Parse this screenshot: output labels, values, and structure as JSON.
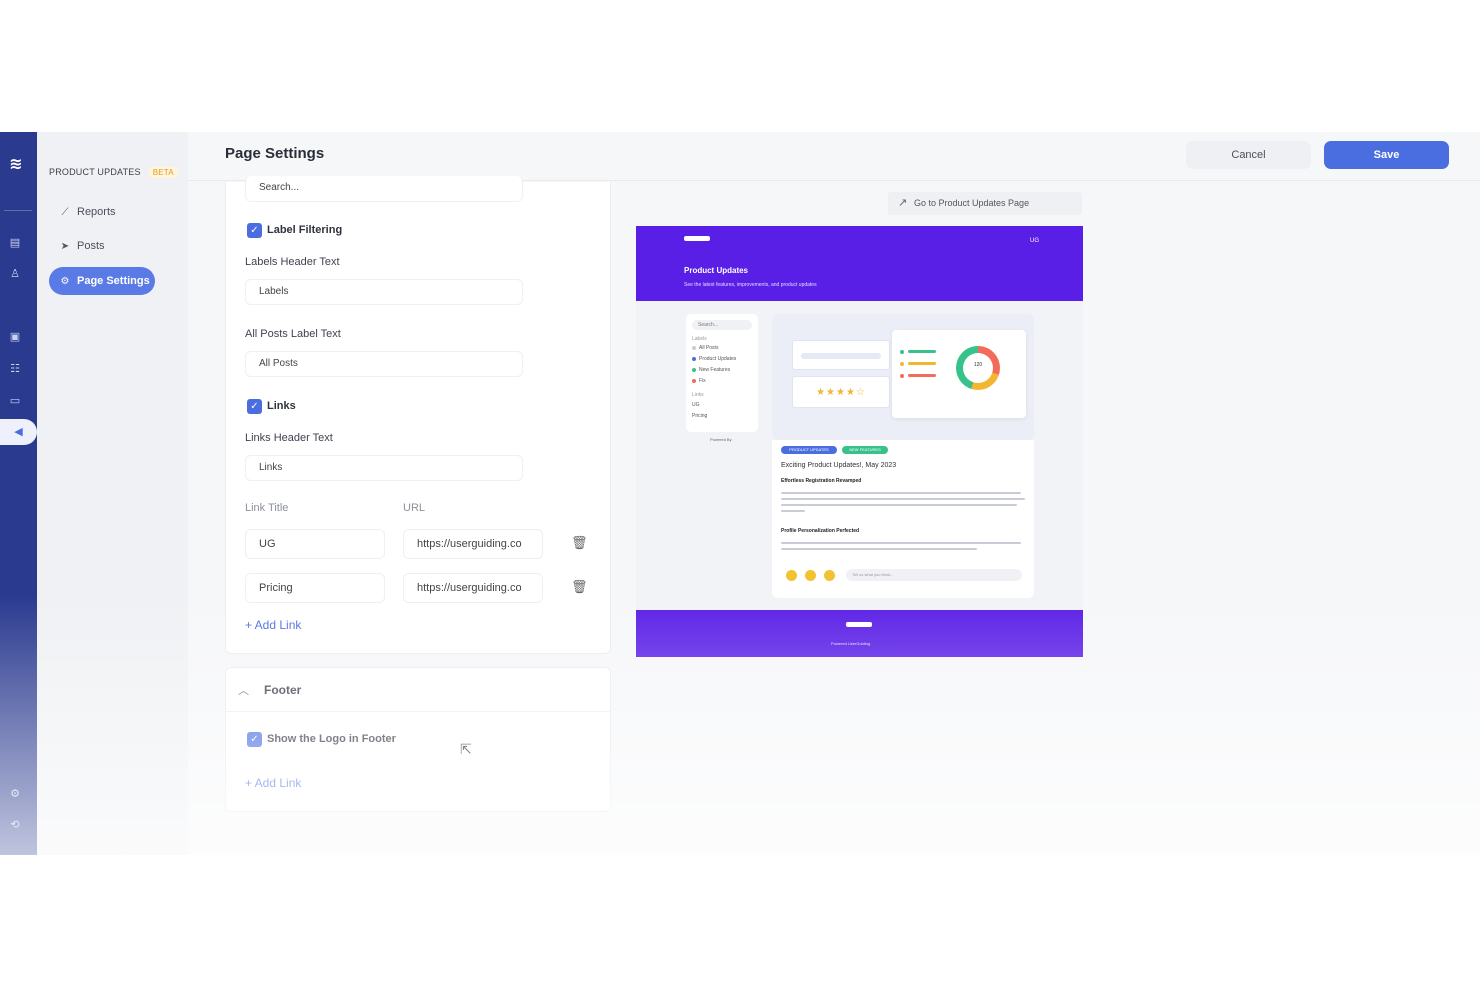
{
  "sidebar": {
    "title": "PRODUCT UPDATES",
    "badge": "BETA",
    "items": [
      {
        "label": "Reports",
        "icon": "chart-icon"
      },
      {
        "label": "Posts",
        "icon": "send-icon"
      },
      {
        "label": "Page Settings",
        "icon": "gear-icon"
      }
    ]
  },
  "header": {
    "title": "Page Settings",
    "cancel_label": "Cancel",
    "save_label": "Save"
  },
  "settings": {
    "search_placeholder": "Search...",
    "label_filtering": {
      "label": "Label Filtering",
      "checked": true
    },
    "labels_header": {
      "label": "Labels Header Text",
      "value": "Labels"
    },
    "all_posts": {
      "label": "All Posts Label Text",
      "value": "All Posts"
    },
    "links": {
      "label": "Links",
      "checked": true
    },
    "links_header": {
      "label": "Links Header Text",
      "value": "Links"
    },
    "link_title_header": "Link Title",
    "url_header": "URL",
    "link_rows": [
      {
        "title": "UG",
        "url": "https://userguiding.co"
      },
      {
        "title": "Pricing",
        "url": "https://userguiding.co"
      }
    ],
    "add_link": "+ Add Link"
  },
  "footer": {
    "title": "Footer",
    "show_logo": {
      "label": "Show the Logo in Footer",
      "checked": true
    },
    "add_link": "+ Add Link"
  },
  "preview": {
    "goto_label": "Go to Product Updates Page",
    "page_title": "Product Updates",
    "page_subtitle": "See the latest features, improvements, and product updates",
    "nav_ug": "UG",
    "search": "Search...",
    "list_items": [
      "Labels",
      "All Posts",
      "Product Updates",
      "New Features",
      "Fix",
      "Links",
      "UG",
      "Pricing"
    ],
    "powered": "Powered By",
    "donut_value": "120",
    "stars": "★★★★☆",
    "tags": [
      "PRODUCT UPDATES",
      "NEW FEATURES"
    ],
    "post_title": "Exciting Product Updates!, May 2023",
    "section_1": "Effortless Registration Revamped",
    "section_2": "Profile Personalization Perfected",
    "reply_placeholder": "Tell us what you think...",
    "footer_powered": "Powered  UserGuiding",
    "colors": {
      "brand": "#5a1fe6",
      "accent": "#4a6ee0"
    }
  }
}
